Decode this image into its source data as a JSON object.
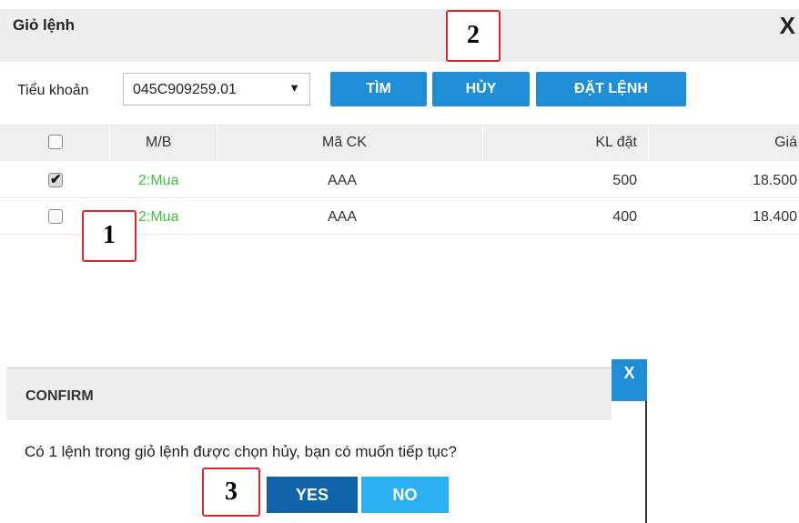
{
  "panel": {
    "title": "Giỏ lệnh",
    "close_label": "X"
  },
  "toolbar": {
    "account_label": "Tiểu khoản",
    "account_value": "045C909259.01",
    "account_caret": "▼",
    "find_label": "TÌM",
    "cancel_label": "HỦY",
    "place_order_label": "ĐẶT LỆNH"
  },
  "table": {
    "headers": [
      "M/B",
      "Mã CK",
      "KL đặt",
      "Giá"
    ],
    "rows": [
      {
        "checked": true,
        "side": "2:Mua",
        "symbol": "AAA",
        "quantity": "500",
        "price": "18.500"
      },
      {
        "checked": false,
        "side": "2:Mua",
        "symbol": "AAA",
        "quantity": "400",
        "price": "18.400"
      }
    ]
  },
  "callouts": [
    "1",
    "2",
    "3"
  ],
  "dialog": {
    "title": "CONFIRM",
    "close_label": "X",
    "message": "Có 1 lệnh trong giỏ lệnh được chọn hủy, bạn có muốn tiếp tục?",
    "yes_label": "YES",
    "no_label": "NO"
  },
  "colors": {
    "primary_blue": "#1e8fd6",
    "yes_blue": "#0f63a8",
    "no_blue": "#2bb0f3",
    "buy_green": "#39c43b",
    "callout_red": "#e0262d"
  },
  "icons": {
    "panel_close": "close-icon",
    "dropdown": "caret-down-icon",
    "checkbox": "checkbox-icon"
  }
}
